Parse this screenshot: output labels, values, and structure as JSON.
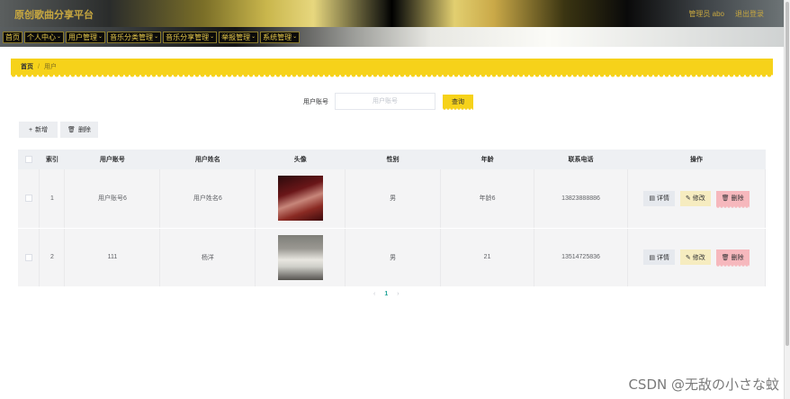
{
  "app": {
    "title": "原创歌曲分享平台"
  },
  "header": {
    "admin_label": "管理员 abo",
    "logout_label": "退出登录"
  },
  "menu": [
    {
      "label": "首页",
      "has_caret": false
    },
    {
      "label": "个人中心",
      "has_caret": true
    },
    {
      "label": "用户管理",
      "has_caret": true
    },
    {
      "label": "音乐分类管理",
      "has_caret": true
    },
    {
      "label": "音乐分享管理",
      "has_caret": true
    },
    {
      "label": "举报管理",
      "has_caret": true
    },
    {
      "label": "系统管理",
      "has_caret": true
    }
  ],
  "breadcrumb": {
    "home": "首页",
    "separator": "/",
    "current": "用户"
  },
  "search": {
    "label": "用户账号",
    "placeholder": "用户账号",
    "button": "查询"
  },
  "actions": {
    "add": "新增",
    "delete": "删除"
  },
  "table": {
    "headers": [
      "索引",
      "用户账号",
      "用户姓名",
      "头像",
      "性别",
      "年龄",
      "联系电话",
      "操作"
    ],
    "rows": [
      {
        "index": "1",
        "account": "用户账号6",
        "name": "用户姓名6",
        "gender": "男",
        "age": "年龄6",
        "phone": "13823888886"
      },
      {
        "index": "2",
        "account": "111",
        "name": "杨洋",
        "gender": "男",
        "age": "21",
        "phone": "13514725836"
      }
    ],
    "ops": {
      "detail": "详情",
      "edit": "修改",
      "delete": "删除"
    }
  },
  "pagination": {
    "prev": "‹",
    "current": "1",
    "next": "›"
  },
  "watermark": "CSDN @无敌の小さな蚊",
  "colors": {
    "accent_yellow": "#f6d21a",
    "title_gold": "#c7a740",
    "pager_active": "#26a69a"
  }
}
